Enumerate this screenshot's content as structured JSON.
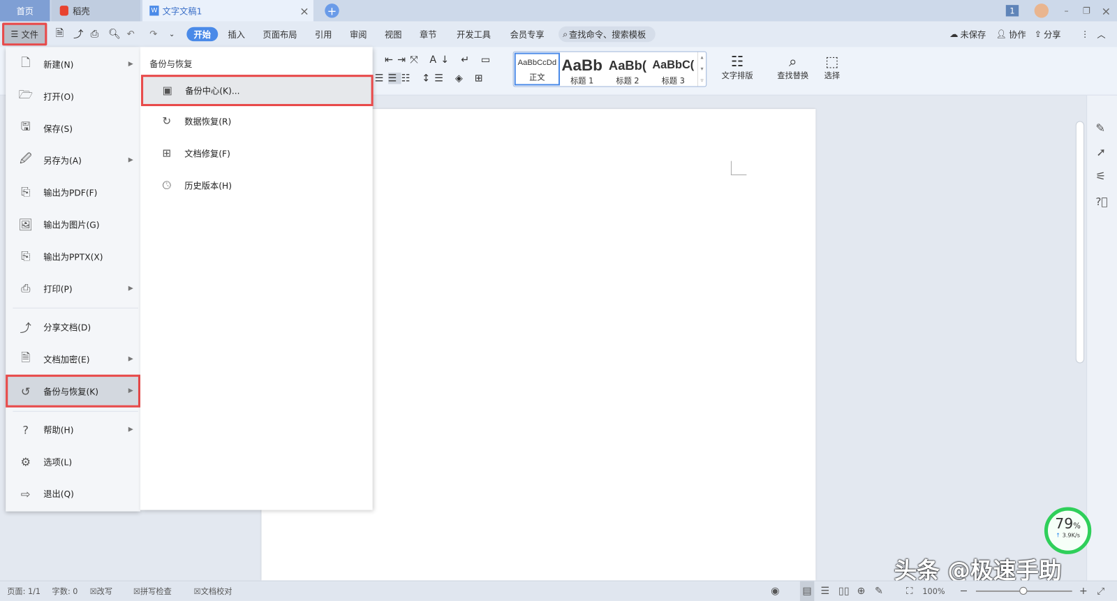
{
  "tabs": [
    {
      "label": "首页"
    },
    {
      "label": "稻壳"
    },
    {
      "label": "文字文稿1"
    }
  ],
  "toolbar": {
    "file_label": "文件",
    "ribbon_tabs": [
      "开始",
      "插入",
      "页面布局",
      "引用",
      "审阅",
      "视图",
      "章节",
      "开发工具",
      "会员专享"
    ],
    "search_placeholder": "查找命令、搜索模板",
    "unsaved": "未保存",
    "collab": "协作",
    "share": "分享",
    "notif_count": "1"
  },
  "ribbon": {
    "styles": [
      {
        "preview": "AaBbCcDd",
        "name": "正文"
      },
      {
        "preview": "AaBb",
        "name": "标题 1"
      },
      {
        "preview": "AaBb(",
        "name": "标题 2"
      },
      {
        "preview": "AaBbC(",
        "name": "标题 3"
      }
    ],
    "text_layout": "文字排版",
    "find_replace": "查找替换",
    "select": "选择"
  },
  "file_menu": {
    "items": [
      {
        "label": "新建(N)",
        "icon": "new-doc-icon",
        "arrow": true
      },
      {
        "label": "打开(O)",
        "icon": "folder-icon",
        "arrow": false
      },
      {
        "label": "保存(S)",
        "icon": "save-icon",
        "arrow": false
      },
      {
        "label": "另存为(A)",
        "icon": "save-as-icon",
        "arrow": true
      },
      {
        "label": "输出为PDF(F)",
        "icon": "pdf-icon",
        "arrow": false
      },
      {
        "label": "输出为图片(G)",
        "icon": "image-icon",
        "arrow": false
      },
      {
        "label": "输出为PPTX(X)",
        "icon": "pptx-icon",
        "arrow": false
      },
      {
        "label": "打印(P)",
        "icon": "print-icon",
        "arrow": true
      },
      {
        "label": "分享文档(D)",
        "icon": "share-icon",
        "arrow": false
      },
      {
        "label": "文档加密(E)",
        "icon": "lock-doc-icon",
        "arrow": true
      },
      {
        "label": "备份与恢复(K)",
        "icon": "backup-icon",
        "arrow": true,
        "selected": true
      },
      {
        "label": "帮助(H)",
        "icon": "help-icon",
        "arrow": true
      },
      {
        "label": "选项(L)",
        "icon": "gear-icon",
        "arrow": false
      },
      {
        "label": "退出(Q)",
        "icon": "exit-icon",
        "arrow": false
      }
    ]
  },
  "submenu": {
    "title": "备份与恢复",
    "items": [
      {
        "label": "备份中心(K)...",
        "icon": "backup-center-icon",
        "selected": true
      },
      {
        "label": "数据恢复(R)",
        "icon": "data-recovery-icon"
      },
      {
        "label": "文档修复(F)",
        "icon": "doc-repair-icon"
      },
      {
        "label": "历史版本(H)",
        "icon": "history-icon"
      }
    ]
  },
  "status": {
    "page": "页面: 1/1",
    "words": "字数: 0",
    "overwrite": "改写",
    "spell": "拼写检查",
    "proof": "文档校对",
    "zoom": "100%"
  },
  "net_widget": {
    "percent": "79",
    "unit": "%",
    "speed": "3.9K/s"
  },
  "watermark": "头条 @极速手助",
  "colors": {
    "accent": "#4a8ae8",
    "highlight_border": "#e84a4a",
    "tab_home": "#7f9fd4"
  }
}
